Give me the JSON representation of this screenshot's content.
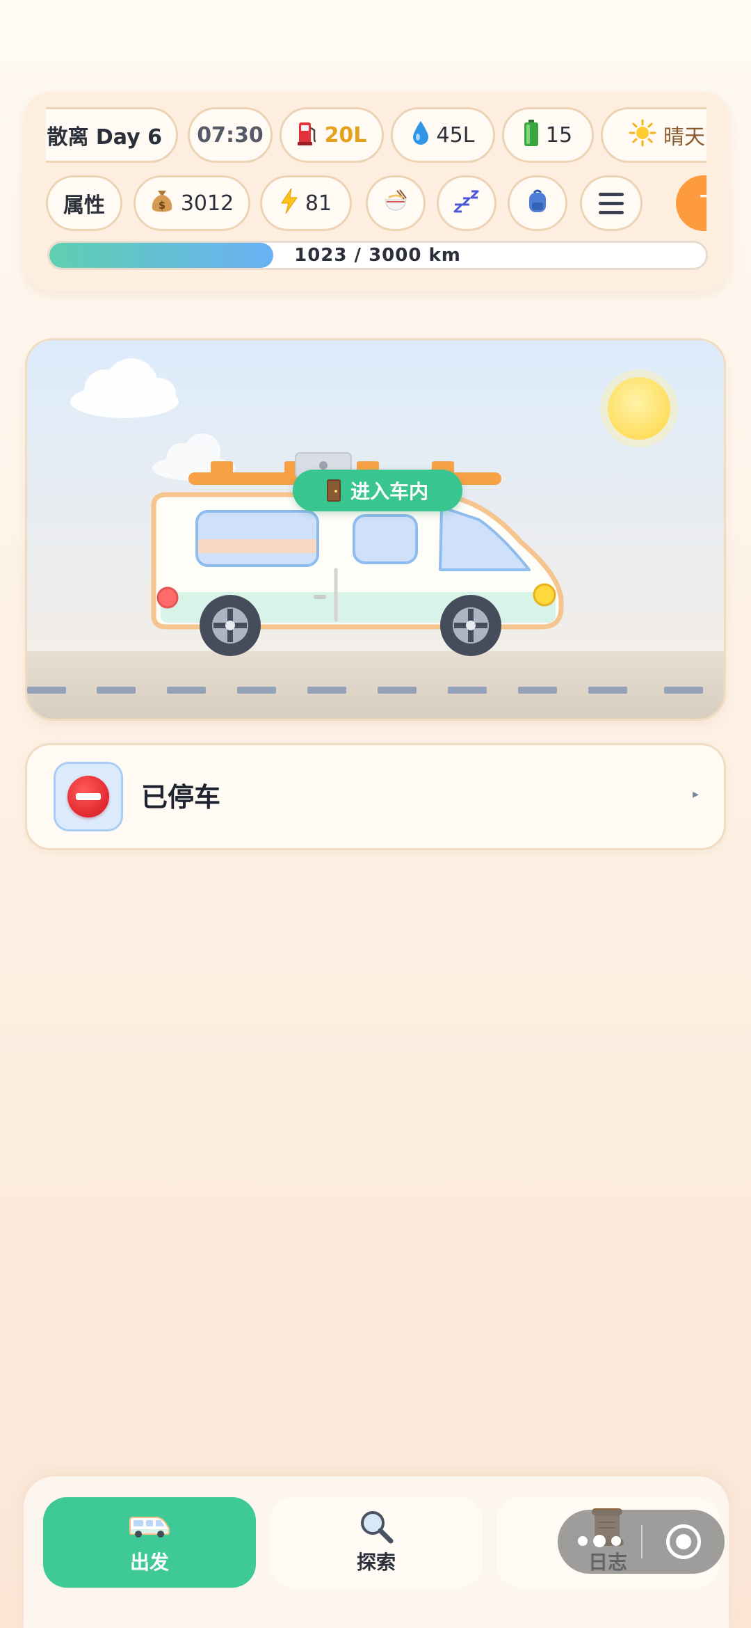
{
  "status_bar": {
    "day_label": "散离 Day 6",
    "time": "07:30",
    "fuel": "20L",
    "water": "45L",
    "battery": "15",
    "weather": "晴天",
    "attributes_label": "属性",
    "money": "3012",
    "energy": "81",
    "next_label": "下一"
  },
  "progress": {
    "text": "1023 / 3000 km",
    "current_km": 1023,
    "total_km": 3000,
    "fraction": 0.341
  },
  "scene": {
    "enter_button_label": "进入车内"
  },
  "status_card": {
    "label": "已停车",
    "arrow": "▸"
  },
  "bottom_nav": {
    "tabs": [
      {
        "label": "出发",
        "active": true
      },
      {
        "label": "探索",
        "active": false
      },
      {
        "label": "日志",
        "active": false
      }
    ]
  },
  "icons": {
    "fuel": "fuel-pump-icon",
    "water": "water-drop-icon",
    "battery": "battery-icon",
    "weather": "sun-icon",
    "money": "money-bag-icon",
    "energy": "lightning-icon",
    "food": "noodle-bowl-icon",
    "sleep": "zzz-icon",
    "bag": "backpack-icon",
    "menu": "menu-icon"
  },
  "colors": {
    "accent_green": "#3ec996",
    "accent_orange": "#fd9b3e",
    "fuel_text": "#e3a21a"
  }
}
